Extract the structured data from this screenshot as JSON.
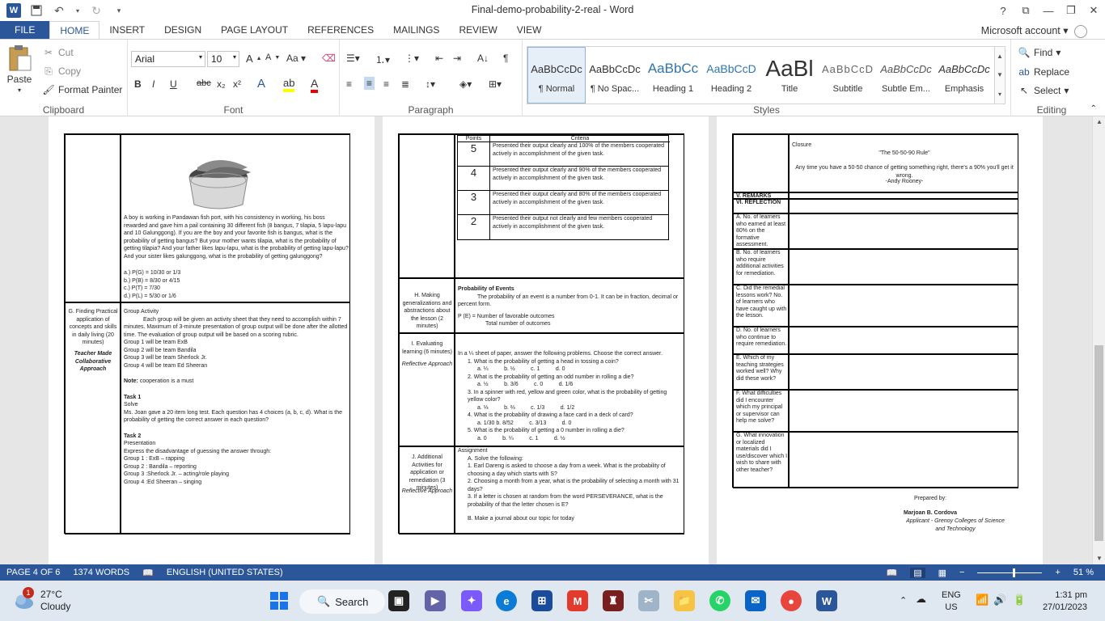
{
  "window": {
    "title": "Final-demo-probability-2-real - Word",
    "help": "?",
    "controls": [
      "ribbon-display",
      "minimize",
      "restore",
      "close"
    ]
  },
  "tabs": [
    "FILE",
    "HOME",
    "INSERT",
    "DESIGN",
    "PAGE LAYOUT",
    "REFERENCES",
    "MAILINGS",
    "REVIEW",
    "VIEW"
  ],
  "account": "Microsoft account",
  "clipboard": {
    "paste": "Paste",
    "cut": "Cut",
    "copy": "Copy",
    "format_painter": "Format Painter",
    "label": "Clipboard"
  },
  "font": {
    "name": "Arial",
    "size": "10",
    "label": "Font",
    "bold": "B",
    "italic": "I",
    "underline": "U",
    "strike": "abc",
    "sub": "x₂",
    "sup": "x²"
  },
  "paragraph": {
    "label": "Paragraph"
  },
  "styles": {
    "label": "Styles",
    "items": [
      {
        "sample": "AaBbCcDc",
        "name": "¶ Normal",
        "selected": true
      },
      {
        "sample": "AaBbCcDc",
        "name": "¶ No Spac..."
      },
      {
        "sample": "AaBbCc",
        "name": "Heading 1"
      },
      {
        "sample": "AaBbCcD",
        "name": "Heading 2"
      },
      {
        "sample": "AaBl",
        "name": "Title"
      },
      {
        "sample": "AaBbCcD",
        "name": "Subtitle"
      },
      {
        "sample": "AaBbCcDc",
        "name": "Subtle Em..."
      },
      {
        "sample": "AaBbCcDc",
        "name": "Emphasis"
      }
    ]
  },
  "editing": {
    "label": "Editing",
    "find": "Find",
    "replace": "Replace",
    "select": "Select"
  },
  "page1": {
    "problem": "A boy is working in Pandawan fish port, with his consistency in working, his boss rewarded and gave him a pail containing 30 different fish (8 bangus, 7 tilapia, 5 lapu-lapu and 10 Galunggong). If you are the boy and your favorite fish is bangus, what is the probability of getting bangus? But your mother wants tilapia, what is the probability of getting tilapia? And your father likes lapu-lapu, what is the probability of getting lapu-lapu? And your sister likes galunggong, what is the probability of getting galunggong?",
    "answers": [
      "a.) P(G) = 10/30 or 1/3",
      "b.) P(B) = 8/30 or 4/15",
      "c.) P(T) = 7/30",
      "d.) P(L) = 5/30 or 1/6"
    ],
    "section_g": {
      "title": "G. Finding Practical application of concepts and skills in daily living (20 minutes)",
      "approach": "Teacher Made Collaborative Approach"
    },
    "group_activity": "Group Activity",
    "group_desc": "Each group will be given an activity sheet that they need to accomplish within 7 minutes. Maximum of 3-minute presentation of group output will be done after the allotted time. The evaluation of group output will be based on a scoring rubric.",
    "groups": [
      "Group 1 will be team ExB",
      "Group 2 will be team Bandila",
      "Group 3 will be team Sherlock Jr.",
      "Group 4 will be team Ed Sheeran"
    ],
    "note_label": "Note:",
    "note": "cooperation is a must",
    "task1_title": "Task 1",
    "task1_sub": "Solve",
    "task1": "Ms. Joan gave a 20 item long test. Each question has 4 choices (a, b, c, d). What is the probability of getting the correct answer in each question?",
    "task2_title": "Task 2",
    "task2_sub": "Presentation",
    "task2": "Express the disadvantage of guessing the answer through:",
    "task2_items": [
      "Group 1 : ExB – rapping",
      "Group 2 : Bandila – reporting",
      "Group 3 :Sherlock Jr. – acting/role playing",
      "Group 4 :Ed Sheeran – singing"
    ]
  },
  "page2": {
    "rubric_header": [
      "Points",
      "Criteria"
    ],
    "rubric": [
      {
        "points": "5",
        "criteria": "Presented their output clearly and 100% of the members cooperated actively in accomplishment of the given task."
      },
      {
        "points": "4",
        "criteria": "Presented their output clearly and 90% of the members cooperated actively in accomplishment of the given task."
      },
      {
        "points": "3",
        "criteria": "Presented their output clearly and 80% of the members cooperated actively in accomplishment of the given task."
      },
      {
        "points": "2",
        "criteria": "Presented their output not clearly and few members cooperated actively in accomplishment of the given task."
      }
    ],
    "section_h": "H. Making generalizations and abstractions about the lesson (2 minutes)",
    "h_title": "Probability of Events",
    "h_text": "The probability of an event is a number from 0-1. It can be in fraction, decimal or percent form.",
    "h_formula": "P (E) = Number of favorable outcomes",
    "h_denominator": "Total number of outcomes",
    "section_i": "I. Evaluating learning (6 minutes)",
    "i_approach": "Reflective Approach",
    "i_intro": "In a ¼ sheet of paper, answer the following problems. Choose the correct answer.",
    "i_items": [
      {
        "q": "1. What is the probability of getting a head in tossing a coin?",
        "c": "a. ¼          b. ½          c. 1          d. 0"
      },
      {
        "q": "2. What is the probability of getting an odd number in rolling a die?",
        "c": "a. ½          b. 3/6          c. 0          d. 1/6"
      },
      {
        "q": "3. In a spinner with red, yellow and green color, what is the probability of getting yellow color?",
        "c": "a. ⅓          b. ⅔          c. 1/3          d. 1/2"
      },
      {
        "q": "4. What is the probability of drawing a face card in a deck of card?",
        "c": "a. 1/30 b. 8/52          c. 3/13          d. 0"
      },
      {
        "q": "5. What is the probability of getting a 0 number in rolling a die?",
        "c": "a. 0          b. ¼          c. 1          d. ½"
      }
    ],
    "section_j": "J. Additional Activities for application or remediation (3 minutes)",
    "j_approach": "Reflective Approach",
    "assignment": "Assignment",
    "j_items": [
      "A. Solve the following:",
      "1. Earl Dareng is asked to choose a day from a week. What is the probability of choosing a day which starts with S?",
      "2. Choosing a month from a year, what is the probability of selecting a month with 31 days?",
      "3. If a letter is chosen at random from the word PERSEVERANCE, what is the probability of that the letter chosen is E?",
      "B. Make a journal about our topic for today"
    ]
  },
  "page3": {
    "closure": "Closure",
    "quote_title": "\"The 50-50-90 Rule\"",
    "quote": "Any time you have a 50-50 chance of getting something right, there's a 90% you'll get it wrong.",
    "quote_author": "-Andy Rooney-",
    "remarks": "V. REMARKS",
    "reflection": "VI. REFLECTION",
    "rows": [
      "A. No. of learners who earned at least 80% on the formative assessment.",
      "B. No. of learners who require additional activities for remediation.",
      "C. Did the remedial lessons work? No. of learners who have caught up with the lesson.",
      "D. No. of learners who continue to require remediation.",
      "E. Which of my teaching strategies worked well? Why did these work?",
      "F. What difficulties did I encounter which my principal or supervisor can help me solve?",
      "G. What innovation or localized materials did I use/discover which I wish to share with other teacher?"
    ],
    "prepared_by": "Prepared by:",
    "name": "Marjoan B. Cordova",
    "position": "Applicant - Grenoy Colleges of Science and Technology"
  },
  "status": {
    "page": "PAGE 4 OF 6",
    "words": "1374 WORDS",
    "language": "ENGLISH (UNITED STATES)",
    "zoom": "51 %"
  },
  "taskbar": {
    "temp": "27°C",
    "weather": "Cloudy",
    "badge": "1",
    "search": "Search",
    "lang1": "ENG",
    "lang2": "US",
    "time": "1:31 pm",
    "date": "27/01/2023"
  }
}
